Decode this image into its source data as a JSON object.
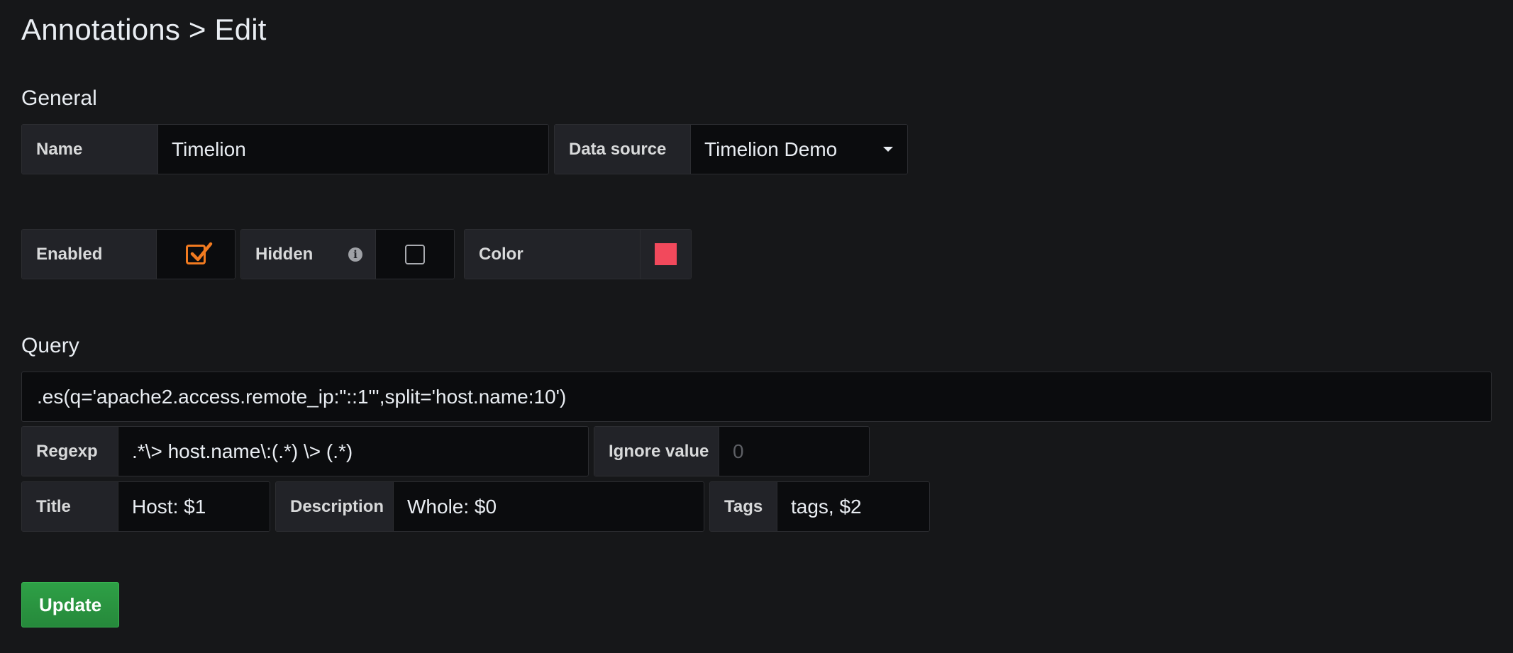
{
  "header": {
    "title": "Annotations > Edit"
  },
  "general": {
    "section_title": "General",
    "name_label": "Name",
    "name_value": "Timelion",
    "datasource_label": "Data source",
    "datasource_value": "Timelion Demo",
    "enabled_label": "Enabled",
    "enabled_checked": true,
    "hidden_label": "Hidden",
    "hidden_checked": false,
    "info_icon": "info-icon",
    "color_label": "Color",
    "color_value": "#f2495c"
  },
  "query": {
    "section_title": "Query",
    "expression": ".es(q='apache2.access.remote_ip:\"::1\"',split='host.name:10')",
    "regexp_label": "Regexp",
    "regexp_value": ".*\\> host.name\\:(.*) \\> (.*)",
    "ignore_value_label": "Ignore value",
    "ignore_value_placeholder": "0",
    "title_label": "Title",
    "title_value": "Host: $1",
    "description_label": "Description",
    "description_value": "Whole: $0",
    "tags_label": "Tags",
    "tags_value": "tags, $2"
  },
  "actions": {
    "update_label": "Update",
    "update_color": "#299c46"
  },
  "colors": {
    "accent": "#f27b20",
    "background": "#161719"
  }
}
